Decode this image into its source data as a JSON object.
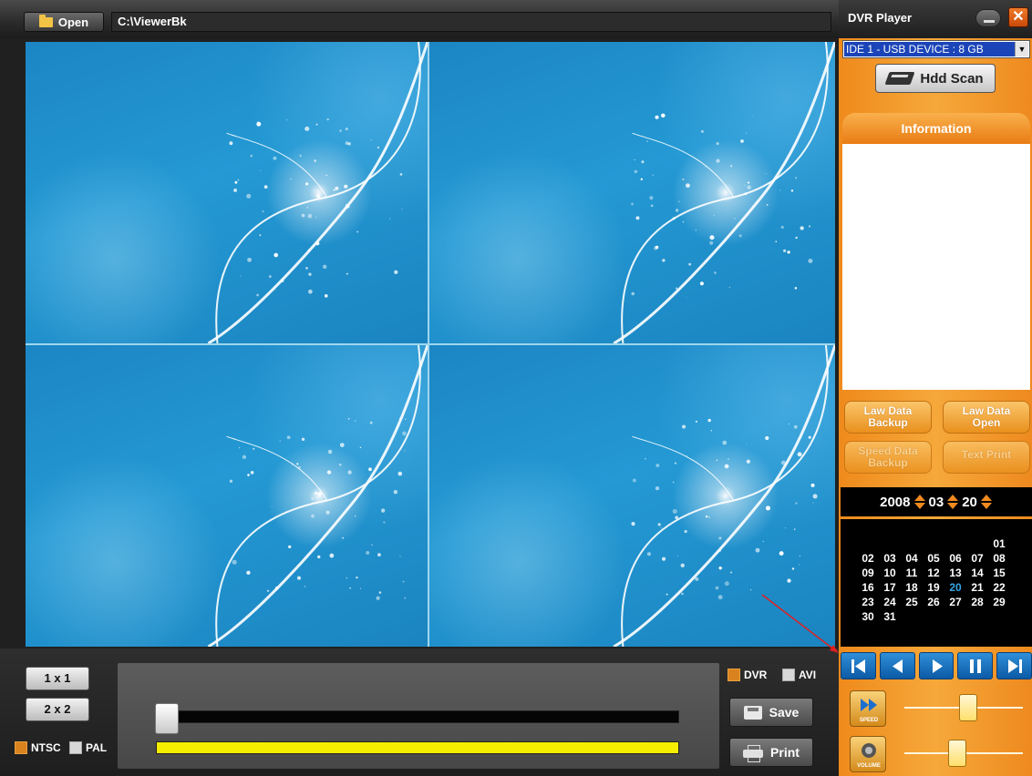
{
  "toolbar": {
    "open_label": "Open",
    "path": "C:\\ViewerBk"
  },
  "video": {
    "layout": "2x2",
    "cells": 4
  },
  "bottom": {
    "layout_1x1": "1 x 1",
    "layout_2x2": "2 x 2",
    "ntsc_label": "NTSC",
    "ntsc_checked": true,
    "pal_label": "PAL",
    "pal_checked": false,
    "dvr_label": "DVR",
    "dvr_checked": true,
    "avi_label": "AVI",
    "avi_checked": false,
    "save_label": "Save",
    "print_label": "Print",
    "timeline_position": 0.0,
    "progress": 1.0
  },
  "panel": {
    "title": "DVR Player",
    "close_glyph": "✕",
    "device_select": "IDE 1 - USB DEVICE : 8 GB",
    "hdd_scan_label": "Hdd Scan",
    "info_header": "Information",
    "info_text": "",
    "law_backup_line1": "Law Data",
    "law_backup_line2": "Backup",
    "law_open_line1": "Law Data",
    "law_open_line2": "Open",
    "speed_backup_line1": "Speed Data",
    "speed_backup_line2": "Backup",
    "text_print_label": "Text Print",
    "speed_label": "SPEED",
    "volume_label": "VOLUME",
    "speed_level": 0.5,
    "volume_level": 0.4
  },
  "date": {
    "year": "2008",
    "month": "03",
    "day": "20"
  },
  "calendar": {
    "leading_blanks": 6,
    "days": [
      "01",
      "02",
      "03",
      "04",
      "05",
      "06",
      "07",
      "08",
      "09",
      "10",
      "11",
      "12",
      "13",
      "14",
      "15",
      "16",
      "17",
      "18",
      "19",
      "20",
      "21",
      "22",
      "23",
      "24",
      "25",
      "26",
      "27",
      "28",
      "29",
      "30",
      "31"
    ],
    "selected": "20"
  },
  "colors": {
    "panel_orange": "#f39a2a",
    "selected_day": "#35a6e6",
    "progress_yellow": "#f5ee00",
    "transport_blue": "#1a78c8"
  }
}
